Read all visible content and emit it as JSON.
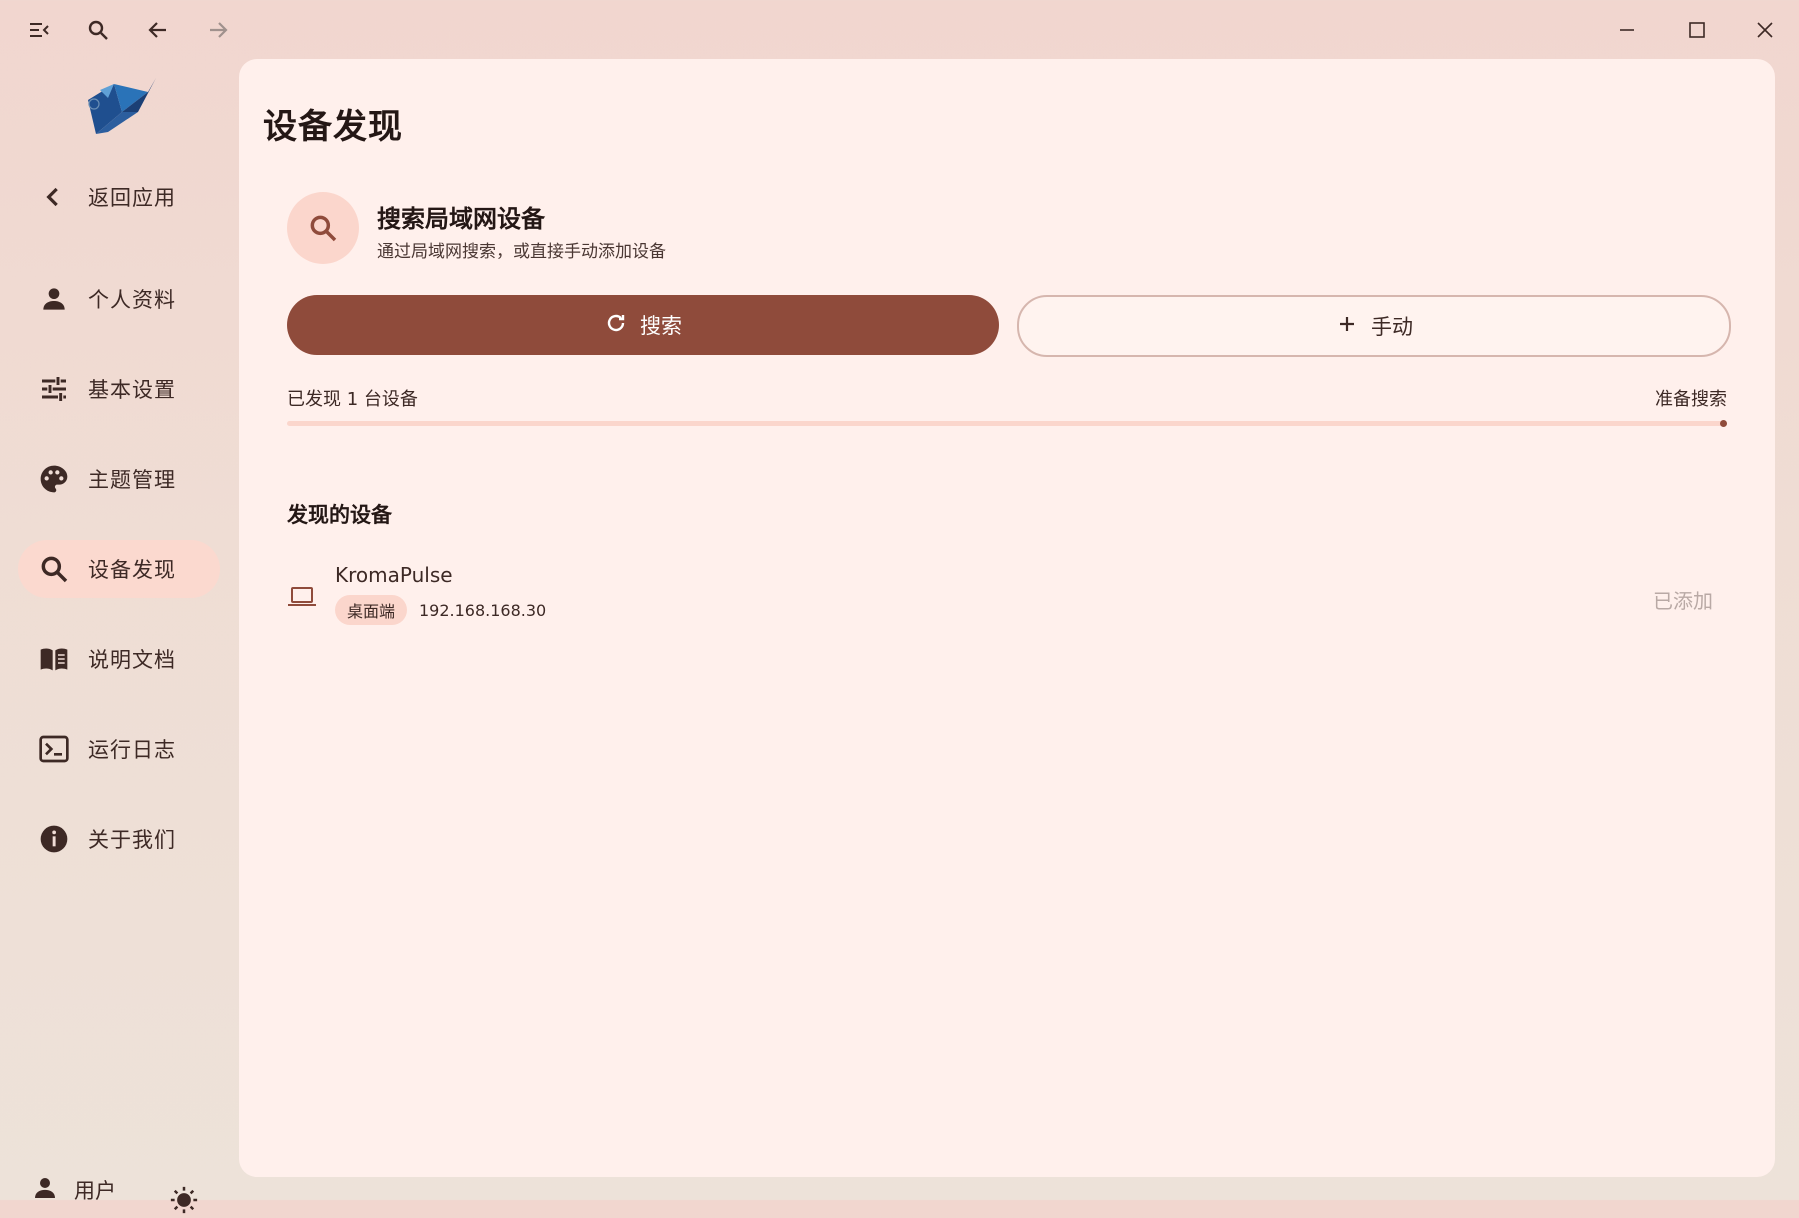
{
  "window": {
    "icons": [
      "menu-collapse-icon",
      "search-icon",
      "back-arrow-icon",
      "forward-arrow-icon",
      "minimize-icon",
      "maximize-icon",
      "close-icon"
    ]
  },
  "sidebar": {
    "items": [
      {
        "label": "返回应用",
        "icon": "chevron-left-icon"
      },
      {
        "label": "个人资料",
        "icon": "person-icon"
      },
      {
        "label": "基本设置",
        "icon": "tune-sliders-icon"
      },
      {
        "label": "主题管理",
        "icon": "palette-icon"
      },
      {
        "label": "设备发现",
        "icon": "search-icon",
        "active": true
      },
      {
        "label": "说明文档",
        "icon": "book-icon"
      },
      {
        "label": "运行日志",
        "icon": "terminal-icon"
      },
      {
        "label": "关于我们",
        "icon": "info-icon"
      }
    ],
    "user_label": "用户",
    "theme_icon": "sun-icon"
  },
  "main": {
    "page_title": "设备发现",
    "card": {
      "title": "搜索局域网设备",
      "subtitle": "通过局域网搜索，或直接手动添加设备"
    },
    "search_button": "搜索",
    "manual_button": "手动",
    "found_count": "已发现 1 台设备",
    "status": "准备搜索",
    "progress": 1.0,
    "section_title": "发现的设备",
    "devices": [
      {
        "name": "KromaPulse",
        "tag": "桌面端",
        "ip": "192.168.168.30",
        "status": "已添加",
        "icon": "laptop-icon"
      }
    ]
  },
  "colors": {
    "accent": "#8f4b3b",
    "accent_light": "#fbd6cc",
    "panel_bg": "#fff0ec",
    "muted_text": "#b9a9a5"
  }
}
